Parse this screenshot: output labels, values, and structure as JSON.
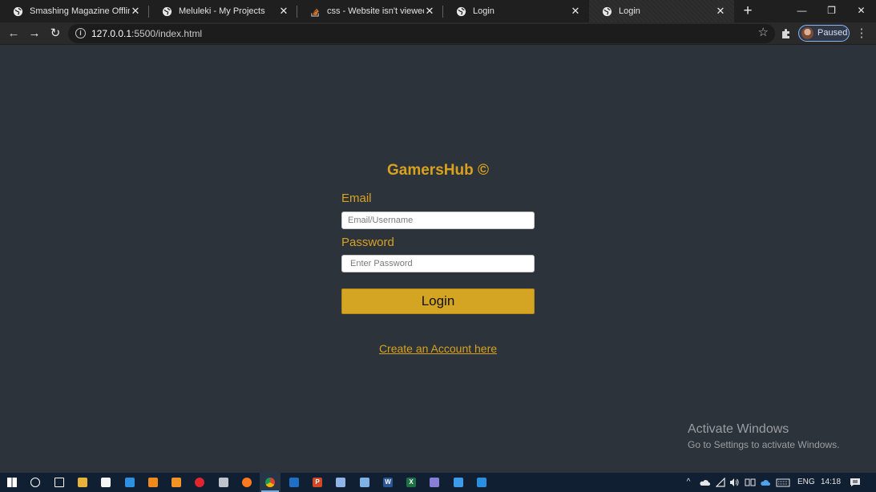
{
  "browser": {
    "tabs": [
      {
        "title": "Smashing Magazine Offline",
        "icon": "globe-icon",
        "active": false
      },
      {
        "title": "Meluleki - My Projects",
        "icon": "globe-icon",
        "active": false
      },
      {
        "title": "css - Website isn't viewed prop",
        "icon": "stackoverflow-icon",
        "active": false
      },
      {
        "title": "Login",
        "icon": "globe-icon",
        "active": false
      },
      {
        "title": "Login",
        "icon": "globe-icon",
        "active": true
      }
    ],
    "close_glyph": "✕",
    "new_tab_glyph": "+",
    "window_controls": {
      "minimize": "—",
      "restore": "❐",
      "close": "✕"
    },
    "nav": {
      "back": "←",
      "forward": "→",
      "reload": "↻"
    },
    "url_host": "127.0.0.1",
    "url_rest": ":5500/index.html",
    "bookmark_glyph": "☆",
    "profile_label": "Paused",
    "menu_glyph": "⋮"
  },
  "login": {
    "brand_title": "GamersHub ©",
    "email_label": "Email",
    "email_placeholder": "Email/Username",
    "email_value": "",
    "password_label": "Password",
    "password_placeholder": "Enter Password",
    "password_value": "",
    "login_button": "Login",
    "create_account_link": "Create an Account here"
  },
  "watermark": {
    "title": "Activate Windows",
    "subtitle": "Go to Settings to activate Windows."
  },
  "taskbar": {
    "apps": [
      {
        "name": "start-icon",
        "color": "#ffffff"
      },
      {
        "name": "search-icon",
        "color": "#ffffff"
      },
      {
        "name": "task-view-icon",
        "color": "#ffffff"
      },
      {
        "name": "file-explorer-icon",
        "color": "#e8b33c"
      },
      {
        "name": "store-icon",
        "color": "#f5f5f5"
      },
      {
        "name": "teamviewer-icon",
        "color": "#2f8fe0"
      },
      {
        "name": "vlc-icon",
        "color": "#f08a1c"
      },
      {
        "name": "sublime-icon",
        "color": "#f29325"
      },
      {
        "name": "opera-icon",
        "color": "#e0252f"
      },
      {
        "name": "camera-icon",
        "color": "#bfc5cc"
      },
      {
        "name": "firefox-icon",
        "color": "#ff7a1d"
      },
      {
        "name": "chrome-icon",
        "color": "#4caf50",
        "active": true
      },
      {
        "name": "outlook-icon",
        "color": "#1f6fc5"
      },
      {
        "name": "powerpoint-icon",
        "color": "#d24726",
        "glyph": "P"
      },
      {
        "name": "shield-icon",
        "color": "#8fb5e6"
      },
      {
        "name": "notes-icon",
        "color": "#7fb2e5"
      },
      {
        "name": "word-icon",
        "color": "#2b5797",
        "glyph": "W"
      },
      {
        "name": "excel-icon",
        "color": "#1e7145",
        "glyph": "X"
      },
      {
        "name": "media-icon",
        "color": "#8a7fd6"
      },
      {
        "name": "mail-icon",
        "color": "#3d9be9"
      },
      {
        "name": "vscode-icon",
        "color": "#2a8fe0"
      }
    ],
    "tray": {
      "chevron": "^",
      "language": "ENG",
      "time": "14:18"
    }
  }
}
